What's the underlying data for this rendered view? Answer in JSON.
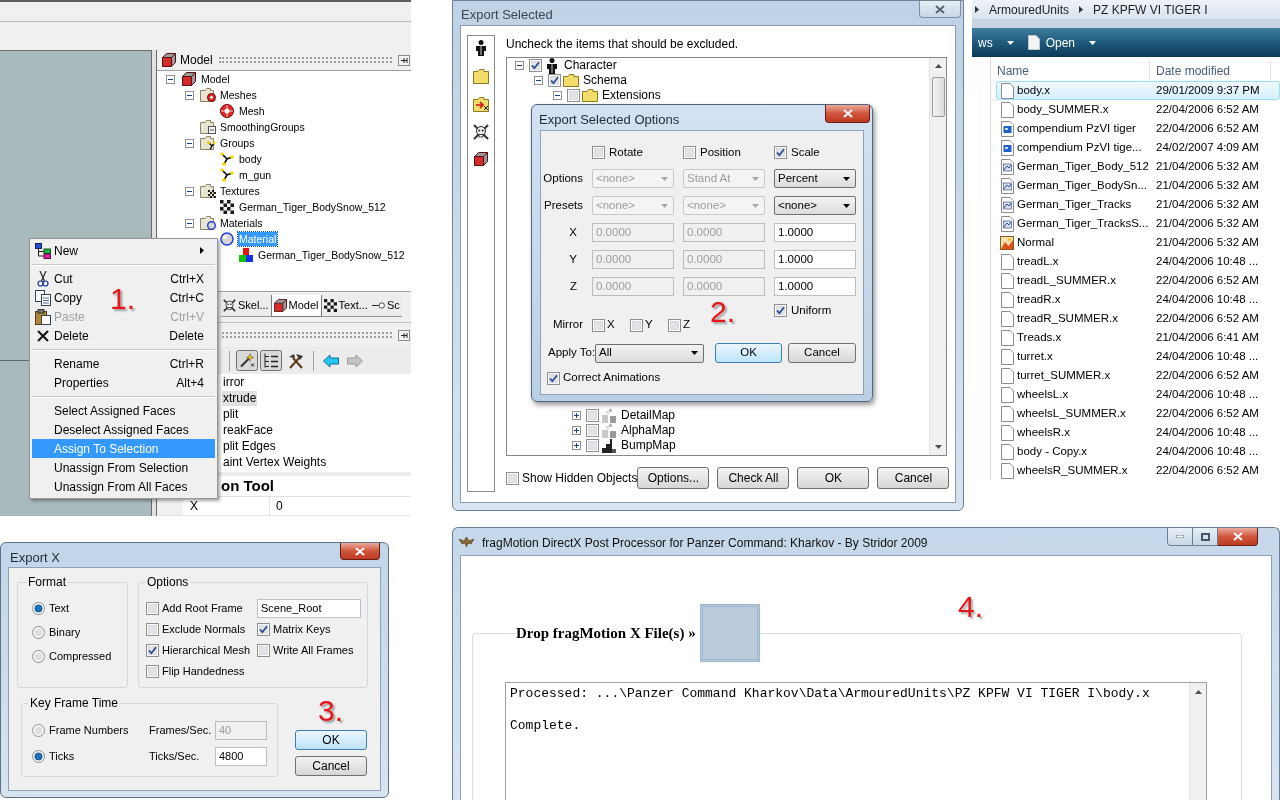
{
  "editor_window": {
    "panel_title": "Model",
    "tree": [
      {
        "label": "Model",
        "kind": "model",
        "expanded": true,
        "selected": false,
        "children": [
          {
            "label": "Meshes",
            "kind": "meshfolder",
            "expanded": true,
            "selected": false,
            "children": [
              {
                "label": "Mesh",
                "kind": "mesh",
                "selected": false
              }
            ]
          },
          {
            "label": "SmoothingGroups",
            "kind": "smoothfolder",
            "selected": false
          },
          {
            "label": "Groups",
            "kind": "groupfolder",
            "expanded": true,
            "selected": false,
            "children": [
              {
                "label": "body",
                "kind": "group",
                "selected": false
              },
              {
                "label": "m_gun",
                "kind": "group",
                "selected": false
              }
            ]
          },
          {
            "label": "Textures",
            "kind": "texturefolder",
            "expanded": true,
            "selected": false,
            "children": [
              {
                "label": "German_Tiger_BodySnow_512",
                "kind": "texture",
                "selected": false
              }
            ]
          },
          {
            "label": "Materials",
            "kind": "materialfolder",
            "expanded": true,
            "selected": false,
            "children": [
              {
                "label": "Material",
                "kind": "material",
                "selected": true,
                "children": [
                  {
                    "label": "German_Tiger_BodySnow_512",
                    "kind": "image",
                    "selected": false
                  }
                ]
              }
            ]
          }
        ]
      }
    ],
    "context_menu": [
      [
        {
          "label": "New",
          "kind": "submenu",
          "disabled": false,
          "selected": false
        }
      ],
      [
        {
          "label": "Cut",
          "shortcut": "Ctrl+X",
          "kind": "command",
          "disabled": false,
          "selected": false
        },
        {
          "label": "Copy",
          "shortcut": "Ctrl+C",
          "kind": "command",
          "disabled": false,
          "selected": false
        },
        {
          "label": "Paste",
          "shortcut": "Ctrl+V",
          "kind": "command",
          "disabled": true,
          "selected": false
        },
        {
          "label": "Delete",
          "shortcut": "Delete",
          "kind": "command",
          "disabled": false,
          "selected": false
        }
      ],
      [
        {
          "label": "Rename",
          "shortcut": "Ctrl+R",
          "kind": "command",
          "disabled": false,
          "selected": false
        },
        {
          "label": "Properties",
          "shortcut": "Alt+4",
          "kind": "command",
          "disabled": false,
          "selected": false
        }
      ],
      [
        {
          "label": "Select Assigned Faces",
          "kind": "command",
          "disabled": false,
          "selected": false
        },
        {
          "label": "Deselect Assigned Faces",
          "kind": "command",
          "disabled": false,
          "selected": false
        },
        {
          "label": "Assign To Selection",
          "kind": "command",
          "disabled": false,
          "selected": true
        },
        {
          "label": "Unassign From Selection",
          "kind": "command",
          "disabled": false,
          "selected": false
        },
        {
          "label": "Unassign From All Faces",
          "kind": "command",
          "disabled": false,
          "selected": false
        }
      ]
    ],
    "annotation": "1.",
    "tabs": [
      {
        "label": "Skel...",
        "selected": false
      },
      {
        "label": "Model",
        "selected": true
      },
      {
        "label": "Text...",
        "selected": false
      },
      {
        "label": "Sc",
        "selected": false
      }
    ],
    "toolbar": [
      {
        "pressed": true,
        "disabled": false
      },
      {
        "pressed": true,
        "disabled": false
      },
      {
        "pressed": false,
        "disabled": false
      },
      {
        "pressed": false,
        "disabled": false
      },
      {
        "pressed": false,
        "disabled": true
      }
    ],
    "tool_list": [
      {
        "label": "irror",
        "selected": false
      },
      {
        "label": "xtrude",
        "selected": true
      },
      {
        "label": "plit",
        "selected": false
      },
      {
        "label": "reakFace",
        "selected": false
      },
      {
        "label": "plit Edges",
        "selected": false
      },
      {
        "label": "aint Vertex Weights",
        "selected": false
      }
    ],
    "tool_heading": "on Tool",
    "properties": [
      {
        "name": "X",
        "value": "0"
      }
    ]
  },
  "export_selected_window": {
    "title": "Export Selected",
    "hint": "Uncheck the items that should be excluded.",
    "tree": [
      {
        "label": "Character",
        "kind": "character",
        "checked": true,
        "expanded": true,
        "children": [
          {
            "label": "Schema",
            "kind": "folder",
            "checked": true,
            "expanded": true,
            "children": [
              {
                "label": "Extensions",
                "kind": "folder",
                "checked": false,
                "expanded": true,
                "children": [
                  {
                    "label": "DetailMap",
                    "kind": "map",
                    "checked": false,
                    "expanded": false
                  },
                  {
                    "label": "AlphaMap",
                    "kind": "map",
                    "checked": false,
                    "expanded": false
                  },
                  {
                    "label": "BumpMap",
                    "kind": "bumpmap",
                    "checked": false,
                    "expanded": false
                  }
                ]
              }
            ]
          }
        ]
      }
    ],
    "show_hidden": {
      "label": "Show Hidden Objects",
      "checked": false
    },
    "buttons": [
      "Options...",
      "Check All",
      "OK",
      "Cancel"
    ],
    "options_dialog": {
      "title": "Export Selected Options",
      "columns": [
        {
          "label": "Rotate",
          "checked": false
        },
        {
          "label": "Position",
          "checked": false
        },
        {
          "label": "Scale",
          "checked": true
        }
      ],
      "rows": [
        {
          "label": "Options",
          "kind": "select",
          "cells": [
            {
              "value": "<none>",
              "disabled": true
            },
            {
              "value": "Stand At",
              "disabled": true
            },
            {
              "value": "Percent",
              "disabled": false
            }
          ]
        },
        {
          "label": "Presets",
          "kind": "select",
          "cells": [
            {
              "value": "<none>",
              "disabled": true
            },
            {
              "value": "<none>",
              "disabled": true
            },
            {
              "value": "<none>",
              "disabled": false
            }
          ]
        },
        {
          "label": "X",
          "kind": "input",
          "cells": [
            {
              "value": "0.0000",
              "disabled": true
            },
            {
              "value": "0.0000",
              "disabled": true
            },
            {
              "value": "1.0000",
              "disabled": false
            }
          ]
        },
        {
          "label": "Y",
          "kind": "input",
          "cells": [
            {
              "value": "0.0000",
              "disabled": true
            },
            {
              "value": "0.0000",
              "disabled": true
            },
            {
              "value": "1.0000",
              "disabled": false
            }
          ]
        },
        {
          "label": "Z",
          "kind": "input",
          "cells": [
            {
              "value": "0.0000",
              "disabled": true
            },
            {
              "value": "0.0000",
              "disabled": true
            },
            {
              "value": "1.0000",
              "disabled": false
            }
          ]
        }
      ],
      "uniform": {
        "label": "Uniform",
        "checked": true
      },
      "mirror": {
        "label": "Mirror",
        "axes": [
          {
            "label": "X",
            "checked": false
          },
          {
            "label": "Y",
            "checked": false
          },
          {
            "label": "Z",
            "checked": false
          }
        ]
      },
      "annotation": "2.",
      "apply_to": {
        "label": "Apply To:",
        "value": "All"
      },
      "buttons": [
        {
          "label": "OK",
          "default": true
        },
        {
          "label": "Cancel",
          "default": false
        }
      ],
      "correct_animations": {
        "label": "Correct Animations",
        "checked": true
      }
    }
  },
  "explorer_window": {
    "breadcrumb": [
      "ArmouredUnits",
      "PZ KPFW VI TIGER I"
    ],
    "toolbar": [
      "ws",
      "Open"
    ],
    "columns": [
      "Name",
      "Date modified"
    ],
    "files": [
      {
        "name": "body.x",
        "date": "29/01/2009 9:37 PM",
        "kind": "document",
        "selected": true
      },
      {
        "name": "body_SUMMER.x",
        "date": "22/04/2006 6:52 AM",
        "kind": "document",
        "selected": false
      },
      {
        "name": "compendium PzVI tiger",
        "date": "22/04/2006 6:52 AM",
        "kind": "webimage",
        "selected": false
      },
      {
        "name": "compendium PzVI tige...",
        "date": "24/02/2007 4:09 AM",
        "kind": "webimage",
        "selected": false
      },
      {
        "name": "German_Tiger_Body_512",
        "date": "21/04/2006 5:32 AM",
        "kind": "texture",
        "selected": false
      },
      {
        "name": "German_Tiger_BodySn...",
        "date": "21/04/2006 5:32 AM",
        "kind": "texture",
        "selected": false
      },
      {
        "name": "German_Tiger_Tracks",
        "date": "21/04/2006 5:32 AM",
        "kind": "texture",
        "selected": false
      },
      {
        "name": "German_Tiger_TracksS...",
        "date": "21/04/2006 5:32 AM",
        "kind": "texture",
        "selected": false
      },
      {
        "name": "Normal",
        "date": "21/04/2006 5:32 AM",
        "kind": "bitmap",
        "selected": false
      },
      {
        "name": "treadL.x",
        "date": "24/04/2006 10:48 ...",
        "kind": "document",
        "selected": false
      },
      {
        "name": "treadL_SUMMER.x",
        "date": "22/04/2006 6:52 AM",
        "kind": "document",
        "selected": false
      },
      {
        "name": "treadR.x",
        "date": "24/04/2006 10:48 ...",
        "kind": "document",
        "selected": false
      },
      {
        "name": "treadR_SUMMER.x",
        "date": "22/04/2006 6:52 AM",
        "kind": "document",
        "selected": false
      },
      {
        "name": "Treads.x",
        "date": "21/04/2006 6:41 AM",
        "kind": "document",
        "selected": false
      },
      {
        "name": "turret.x",
        "date": "24/04/2006 10:48 ...",
        "kind": "document",
        "selected": false
      },
      {
        "name": "turret_SUMMER.x",
        "date": "22/04/2006 6:52 AM",
        "kind": "document",
        "selected": false
      },
      {
        "name": "wheelsL.x",
        "date": "24/04/2006 10:48 ...",
        "kind": "document",
        "selected": false
      },
      {
        "name": "wheelsL_SUMMER.x",
        "date": "22/04/2006 6:52 AM",
        "kind": "document",
        "selected": false
      },
      {
        "name": "wheelsR.x",
        "date": "24/04/2006 10:48 ...",
        "kind": "document",
        "selected": false
      },
      {
        "name": "body - Copy.x",
        "date": "24/04/2006 10:48 ...",
        "kind": "document",
        "selected": false
      },
      {
        "name": "wheelsR_SUMMER.x",
        "date": "22/04/2006 6:52 AM",
        "kind": "document",
        "selected": false
      }
    ]
  },
  "export_x_dialog": {
    "title": "Export X",
    "format": {
      "label": "Format",
      "options": [
        {
          "label": "Text",
          "selected": true
        },
        {
          "label": "Binary",
          "selected": false
        },
        {
          "label": "Compressed",
          "selected": false
        }
      ]
    },
    "options": {
      "label": "Options",
      "items": [
        {
          "kind": "checkbox",
          "label": "Add Root Frame",
          "checked": false
        },
        {
          "kind": "field",
          "value": "Scene_Root"
        },
        {
          "kind": "checkbox",
          "label": "Exclude Normals",
          "checked": false
        },
        {
          "kind": "checkbox",
          "label": "Matrix Keys",
          "checked": true
        },
        {
          "kind": "checkbox",
          "label": "Hierarchical Mesh",
          "checked": true
        },
        {
          "kind": "checkbox",
          "label": "Write All Frames",
          "checked": false
        },
        {
          "kind": "checkbox",
          "label": "Flip Handedness",
          "checked": false
        }
      ]
    },
    "key_frame_time": {
      "label": "Key Frame Time",
      "options": [
        {
          "label": "Frame Numbers",
          "selected": false
        },
        {
          "label": "Ticks",
          "selected": true
        }
      ],
      "fields": [
        {
          "label": "Frames/Sec.",
          "value": "40",
          "disabled": true
        },
        {
          "label": "Ticks/Sec.",
          "value": "4800",
          "disabled": false
        }
      ]
    },
    "annotation": "3.",
    "buttons": [
      {
        "label": "OK",
        "default": true
      },
      {
        "label": "Cancel",
        "default": false
      }
    ]
  },
  "post_processor_window": {
    "title": "fragMotion DirectX Post Processor for Panzer Command: Kharkov - By Stridor 2009",
    "annotation": "4.",
    "drop_label": "Drop fragMotion X File(s) »",
    "log": [
      "Processed: ...\\Panzer Command Kharkov\\Data\\ArmouredUnits\\PZ KPFW VI TIGER I\\body.x",
      "Complete."
    ]
  }
}
